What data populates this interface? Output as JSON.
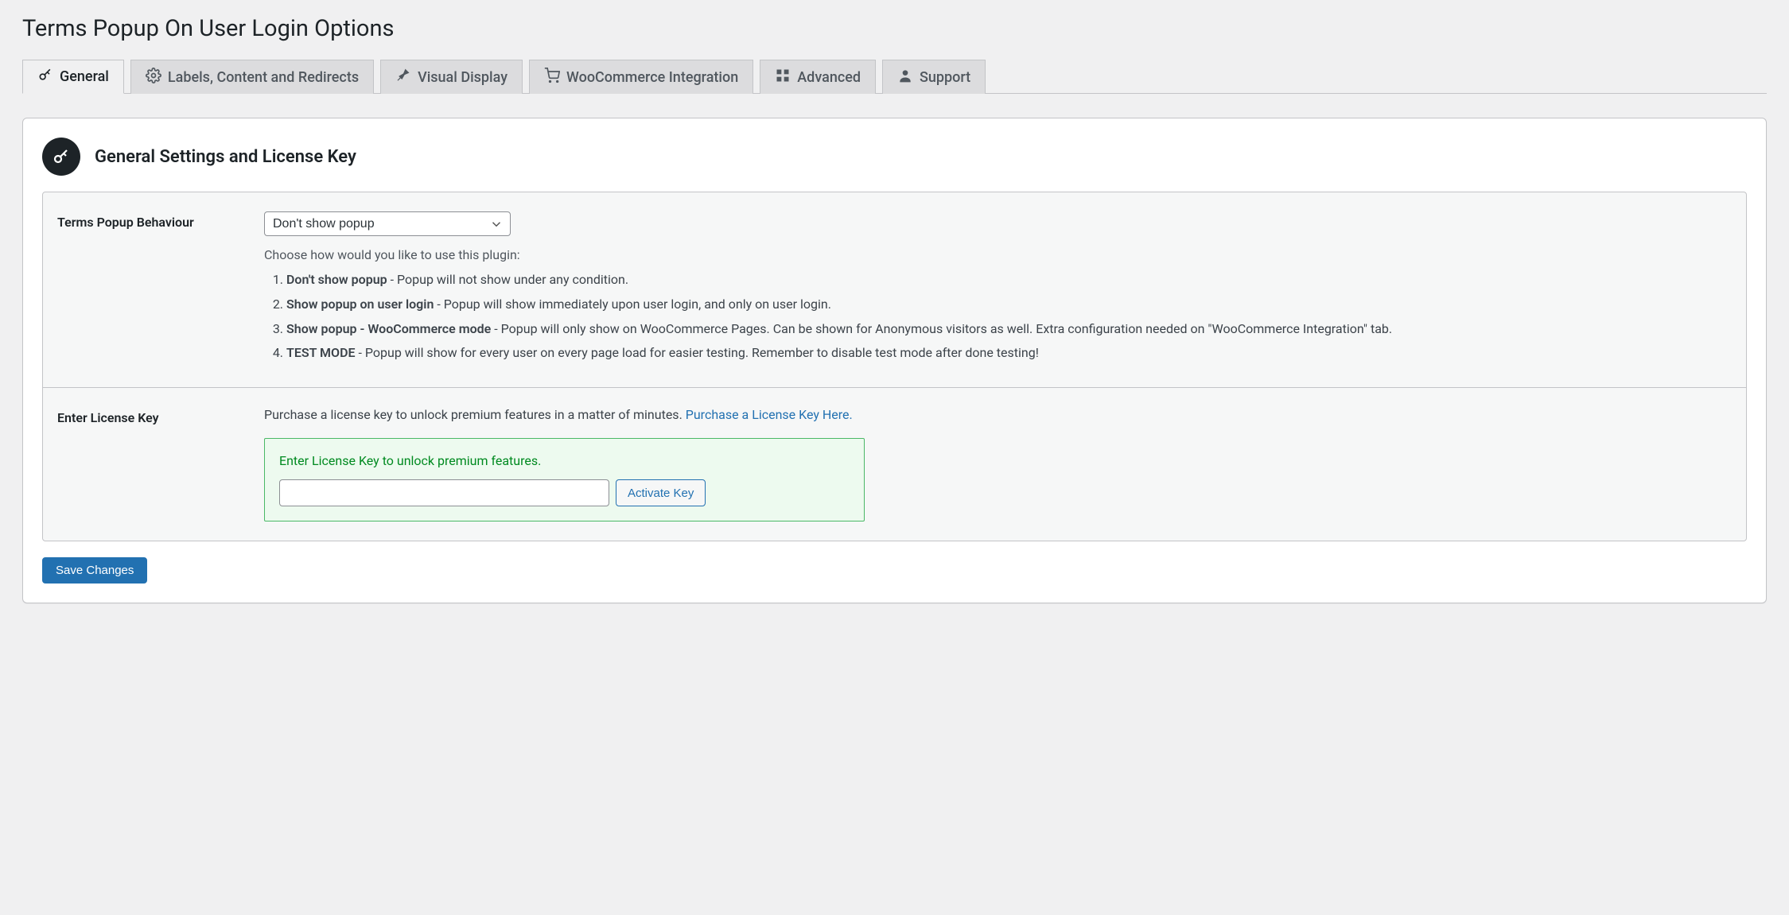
{
  "page_title": "Terms Popup On User Login Options",
  "tabs": [
    {
      "label": "General"
    },
    {
      "label": "Labels, Content and Redirects"
    },
    {
      "label": "Visual Display"
    },
    {
      "label": "WooCommerce Integration"
    },
    {
      "label": "Advanced"
    },
    {
      "label": "Support"
    }
  ],
  "section": {
    "title": "General Settings and License Key"
  },
  "behaviour": {
    "label": "Terms Popup Behaviour",
    "selected": "Don't show popup",
    "helper": "Choose how would you like to use this plugin:",
    "options": [
      {
        "name": "Don't show popup",
        "desc": " - Popup will not show under any condition."
      },
      {
        "name": "Show popup on user login",
        "desc": " - Popup will show immediately upon user login, and only on user login."
      },
      {
        "name": "Show popup - WooCommerce mode",
        "desc": " - Popup will only show on WooCommerce Pages. Can be shown for Anonymous visitors as well. Extra configuration needed on \"WooCommerce Integration\" tab."
      },
      {
        "name": "TEST MODE",
        "desc": " - Popup will show for every user on every page load for easier testing. Remember to disable test mode after done testing!"
      }
    ]
  },
  "license": {
    "label": "Enter License Key",
    "intro_text": "Purchase a license key to unlock premium features in a matter of minutes. ",
    "intro_link": "Purchase a License Key Here.",
    "box_msg": "Enter License Key to unlock premium features.",
    "input_value": "",
    "activate_label": "Activate Key"
  },
  "save_label": "Save Changes"
}
